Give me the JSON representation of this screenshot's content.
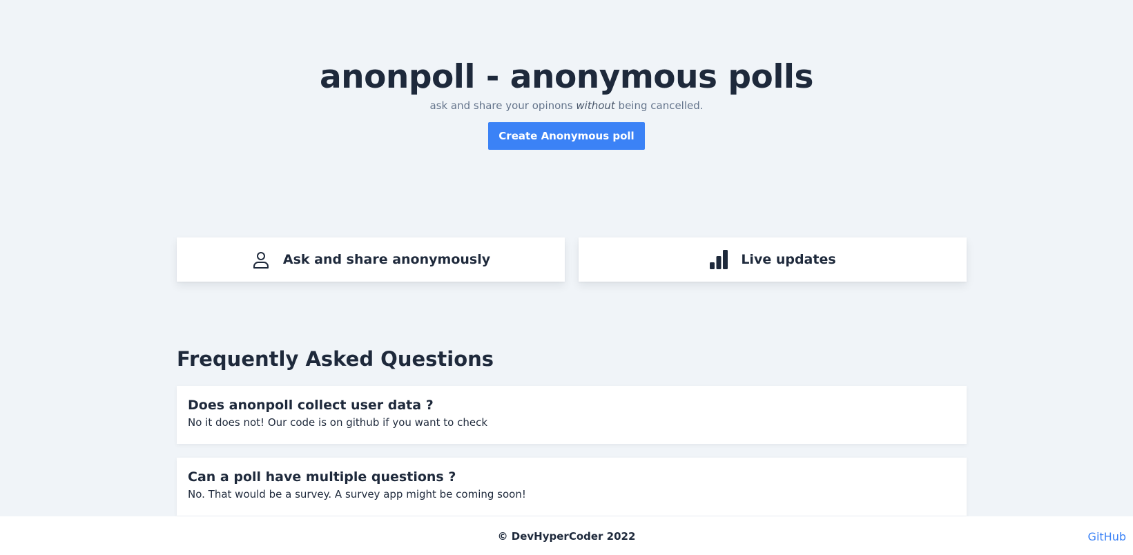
{
  "hero": {
    "title": "anonpoll - anonymous polls",
    "subtitle_before": "ask and share your opinons ",
    "subtitle_emphasis": "without",
    "subtitle_after": " being cancelled.",
    "cta_label": "Create Anonymous poll"
  },
  "features": [
    {
      "icon": "user-icon",
      "label": "Ask and share anonymously"
    },
    {
      "icon": "bar-chart-icon",
      "label": "Live updates"
    }
  ],
  "faq": {
    "heading": "Frequently Asked Questions",
    "items": [
      {
        "question": "Does anonpoll collect user data ?",
        "answer": "No it does not! Our code is on github if you want to check"
      },
      {
        "question": "Can a poll have multiple questions ?",
        "answer": "No. That would be a survey. A survey app might be coming soon!"
      }
    ]
  },
  "footer": {
    "copyright": "© DevHyperCoder 2022",
    "github_label": "GitHub"
  },
  "colors": {
    "background": "#f0f4f8",
    "accent": "#3b82f6",
    "text": "#1e293b",
    "muted": "#64748b"
  }
}
